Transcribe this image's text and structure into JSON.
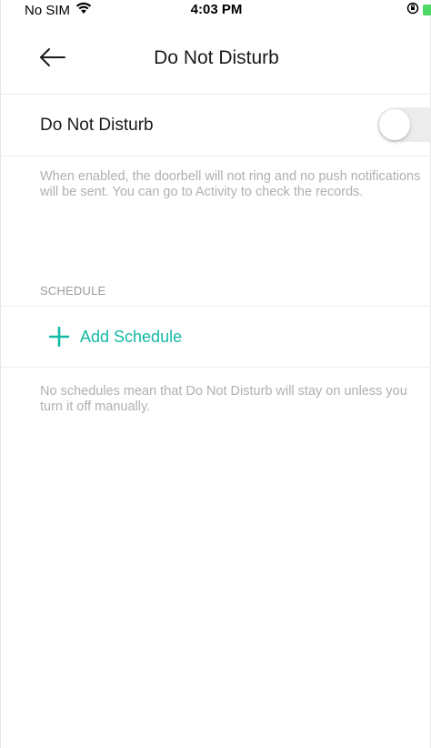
{
  "status_bar": {
    "carrier": "No SIM",
    "time": "4:03 PM"
  },
  "header": {
    "title": "Do Not Disturb"
  },
  "dnd": {
    "label": "Do Not Disturb",
    "enabled": false,
    "description": "When enabled, the doorbell will not ring and no push notifications will be sent. You can go to Activity to check the records."
  },
  "schedule": {
    "section_title": "SCHEDULE",
    "add_label": "Add Schedule",
    "note": "No schedules mean that Do Not Disturb will stay on unless you turn it off manually."
  },
  "colors": {
    "accent": "#14b8a6",
    "battery": "#4cd964"
  }
}
